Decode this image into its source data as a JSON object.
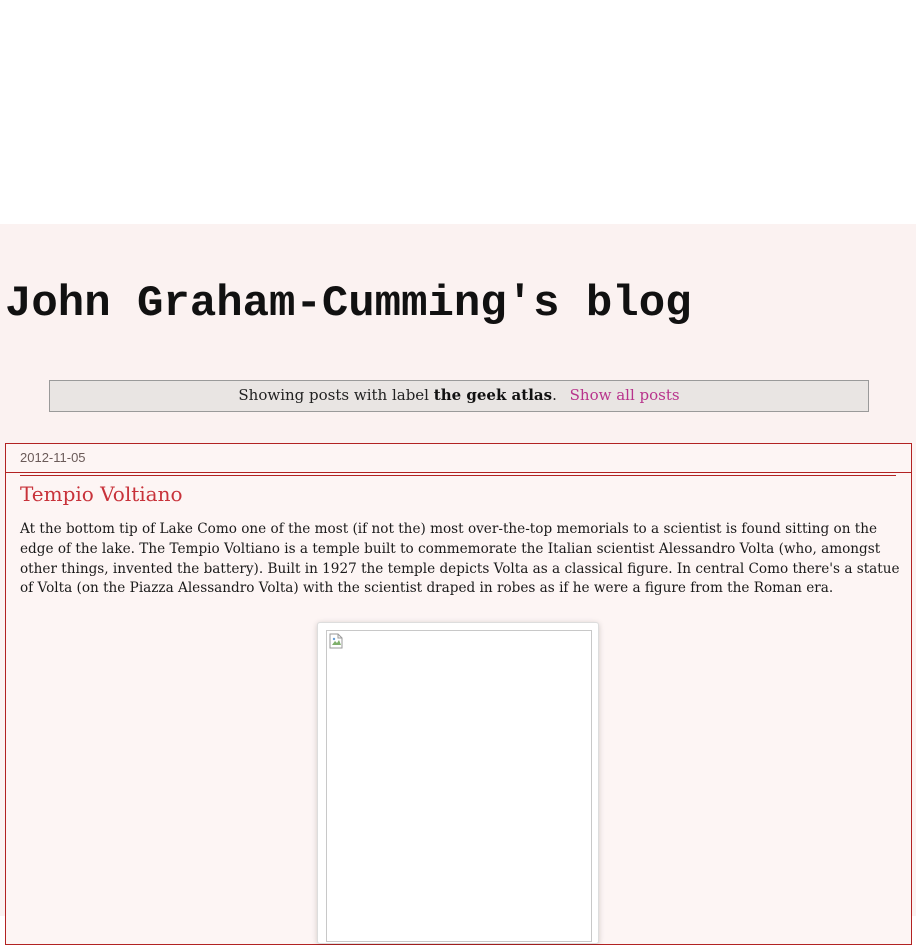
{
  "blog": {
    "title": "John Graham-Cumming's blog"
  },
  "label_bar": {
    "prefix": "Showing posts with label",
    "label": "the geek atlas",
    "suffix": ".",
    "show_all_link": "Show all posts"
  },
  "post": {
    "date": "2012-11-05",
    "title": "Tempio Voltiano",
    "body": "At the bottom tip of Lake Como one of the most (if not the) most over-the-top memorials to a scientist is found sitting on the edge of the lake. The Tempio Voltiano is a temple built to commemorate the Italian scientist Alessandro Volta (who, amongst other things, invented the battery). Built in 1927 the temple depicts Volta as a classical figure. In central Como there's a statue of Volta (on the Piazza Alessandro Volta) with the scientist draped in robes as if he were a figure from the Roman era.",
    "image_icon": "broken-image-icon"
  },
  "colors": {
    "page_background": "#fbf2f1",
    "post_border": "#b22222",
    "post_title": "#c8323a",
    "link": "#b8338c",
    "label_bar_background": "#e9e5e3"
  }
}
